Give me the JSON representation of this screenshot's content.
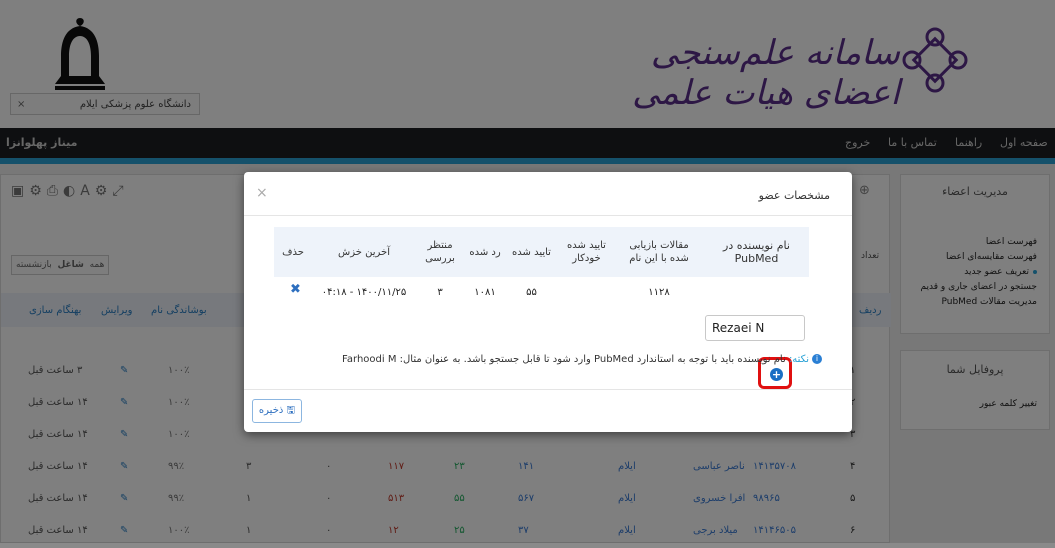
{
  "header": {
    "system_title": "سامانه علم‌سنجی اعضای هیات علمی",
    "university_tab": "دانشگاه علوم پزشکی ایلام",
    "tab_close": "×"
  },
  "nav": {
    "home": "صفحه اول",
    "guide": "راهنما",
    "contact": "تماس با ما",
    "logout": "خروج",
    "user": "میناز پهلوانزا"
  },
  "sidebar": {
    "members_header": "مدیریت اعضاء",
    "items": [
      "فهرست اعضا",
      "فهرست مقایسه‌ای اعضا",
      "تعریف عضو جدید",
      "جستجو در اعضای جاری و قدیم",
      "مدیریت مقالات PubMed"
    ],
    "profile_header": "پروفایل شما",
    "change_password": "تغییر کلمه عبور"
  },
  "main": {
    "filters": [
      "همه",
      "شاغل",
      "بازنشسته"
    ],
    "col_update": "بهنگام سازی",
    "col_edit": "ویرایش",
    "col_view": "بوشاندگی نام",
    "col_radif": "ردیف",
    "count_label": "تعداد",
    "rows": [
      {
        "update": "۳ ساعت قبل",
        "pct": "۱۰۰٪",
        "r": "۱"
      },
      {
        "update": "۱۴ ساعت قبل",
        "pct": "۱۰۰٪",
        "r": "۲"
      },
      {
        "update": "۱۴ ساعت قبل",
        "pct": "۱۰۰٪",
        "r": "۳"
      },
      {
        "update": "۱۴ ساعت قبل",
        "pct": "۹۹٪",
        "c1": "۳",
        "c2": "۰",
        "c3": "۱۱۷",
        "c4": "۲۳",
        "c5": "۱۴۱",
        "uni": "ایلام",
        "name": "ناصر عباسی",
        "code": "۱۴۱۳۵۷۰۸",
        "r": "۴"
      },
      {
        "update": "۱۴ ساعت قبل",
        "pct": "۹۹٪",
        "c1": "۱",
        "c2": "۰",
        "c3": "۵۱۳",
        "c4": "۵۵",
        "c5": "۵۶۷",
        "uni": "ایلام",
        "name": "افرا خسروی",
        "code": "۹۸۹۶۵",
        "r": "۵"
      },
      {
        "update": "۱۴ ساعت قبل",
        "pct": "۱۰۰٪",
        "c1": "۱",
        "c2": "۰",
        "c3": "۱۲",
        "c4": "۲۵",
        "c5": "۳۷",
        "uni": "ایلام",
        "name": "میلاد برجی",
        "code": "۱۴۱۴۶۵۰۵",
        "r": "۶"
      }
    ]
  },
  "modal": {
    "title": "مشخصات عضو",
    "close": "×",
    "headers": {
      "pubmed_name": "نام نویسنده در PubMed",
      "articles": "مقالات بازیابی شده با این نام",
      "auto_confirmed": "تایید شده خودکار",
      "confirmed": "تایید شده",
      "rejected": "رد شده",
      "pending": "منتظر بررسی",
      "last_crawl": "آخرین خزش",
      "delete": "حذف"
    },
    "row": {
      "pubmed_name": "Rezaei N",
      "articles": "۱۱۲۸",
      "auto_confirmed": "",
      "confirmed": "۵۵",
      "rejected": "۱۰۸۱",
      "pending": "۳",
      "last_crawl": "۱۴۰۰/۱۱/۲۵ - ۰۴:۱۸",
      "delete": "✖"
    },
    "add_icon": "+",
    "note_label": "نکته:",
    "note_text": "نام نویسنده باید با توجه به استاندارد PubMed وارد شود تا قابل جستجو باشد. به عنوان مثال: Farhoodi M",
    "save": "ذخیره"
  },
  "colors": {
    "accent": "#2aa2d6",
    "brand": "#5a2e8a",
    "highlight": "#e01010",
    "link": "#1a6fc4"
  }
}
